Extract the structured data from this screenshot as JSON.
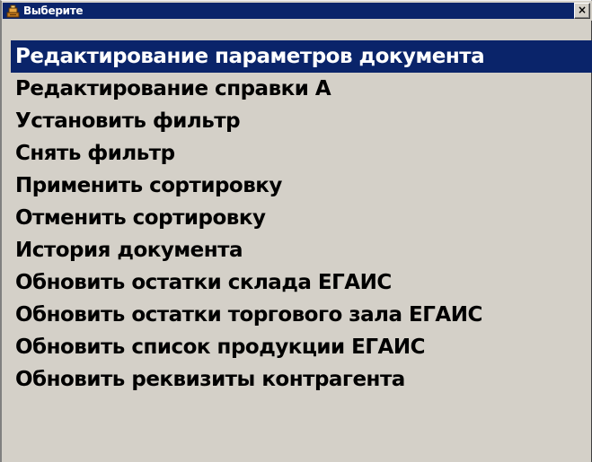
{
  "window": {
    "title": "Выберите",
    "close_label": "×"
  },
  "menu": {
    "selected_index": 0,
    "items": [
      {
        "label": "Редактирование параметров документа"
      },
      {
        "label": "Редактирование справки А"
      },
      {
        "label": "Установить фильтр"
      },
      {
        "label": "Снять фильтр"
      },
      {
        "label": "Применить сортировку"
      },
      {
        "label": "Отменить сортировку"
      },
      {
        "label": "История документа"
      },
      {
        "label": "Обновить остатки склада ЕГАИС"
      },
      {
        "label": "Обновить остатки торгового зала ЕГАИС"
      },
      {
        "label": "Обновить список продукции ЕГАИС"
      },
      {
        "label": "Обновить реквизиты контрагента"
      }
    ]
  },
  "colors": {
    "titlebar": "#0a246a",
    "selection": "#0a246a",
    "window_bg": "#d4d0c8"
  },
  "icons": {
    "app": "cash-register-icon",
    "close": "close-icon"
  }
}
